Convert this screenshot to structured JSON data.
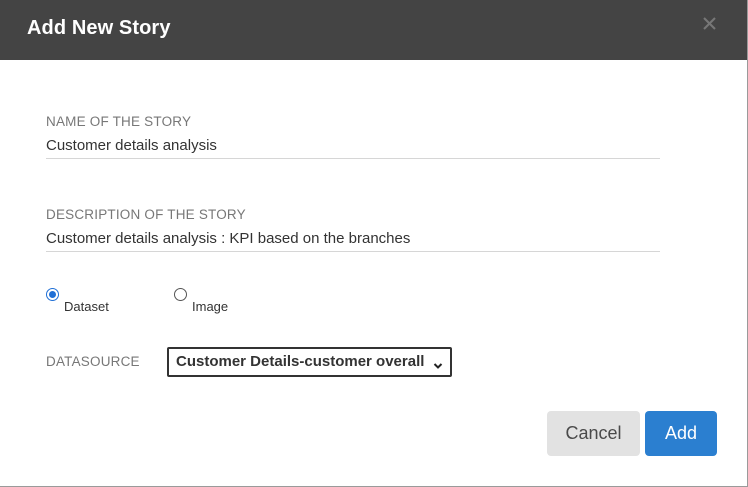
{
  "dialog": {
    "title": "Add New Story",
    "close_icon": "close-icon"
  },
  "name_field": {
    "label": "NAME OF THE STORY",
    "value": "Customer details analysis"
  },
  "description_field": {
    "label": "DESCRIPTION OF THE STORY",
    "value": "Customer details analysis : KPI based on the branches"
  },
  "source_type": {
    "options": [
      {
        "label": "Dataset",
        "checked": true
      },
      {
        "label": "Image",
        "checked": false
      }
    ]
  },
  "datasource": {
    "label": "DATASOURCE",
    "selected": "Customer Details-customer overall"
  },
  "actions": {
    "cancel_label": "Cancel",
    "add_label": "Add"
  },
  "colors": {
    "header_bg": "#444444",
    "accent": "#2b7fd0",
    "radio_checked": "#1f6fd6"
  }
}
